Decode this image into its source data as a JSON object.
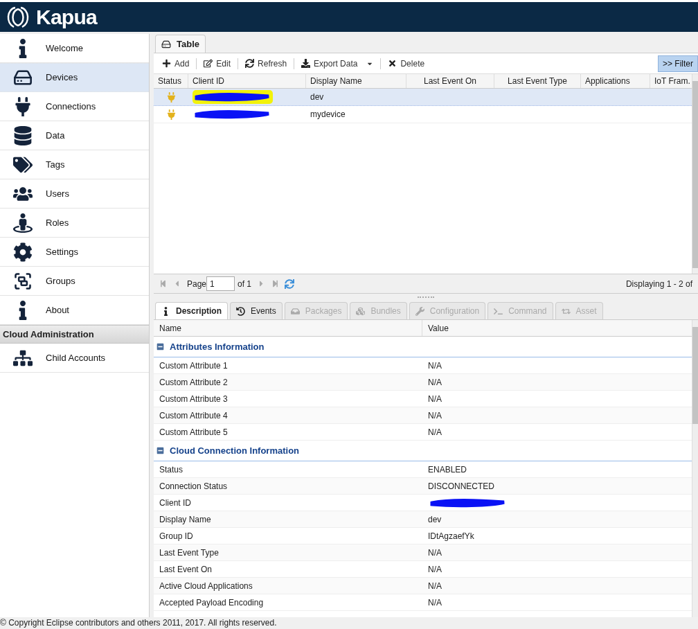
{
  "header": {
    "title": "Kapua"
  },
  "sidebar": {
    "items": [
      {
        "label": "Welcome",
        "selected": false
      },
      {
        "label": "Devices",
        "selected": true
      },
      {
        "label": "Connections",
        "selected": false
      },
      {
        "label": "Data",
        "selected": false
      },
      {
        "label": "Tags",
        "selected": false
      },
      {
        "label": "Users",
        "selected": false
      },
      {
        "label": "Roles",
        "selected": false
      },
      {
        "label": "Settings",
        "selected": false
      },
      {
        "label": "Groups",
        "selected": false
      },
      {
        "label": "About",
        "selected": false
      }
    ],
    "section": {
      "title": "Cloud Administration",
      "items": [
        {
          "label": "Child Accounts",
          "selected": false
        }
      ]
    }
  },
  "main_tab": {
    "label": "Table",
    "selected": true
  },
  "toolbar": {
    "buttons": [
      "Add",
      "Edit",
      "Refresh",
      "Export Data",
      "Delete"
    ],
    "filter_button": ">> Filter"
  },
  "table": {
    "columns": [
      "Status",
      "Client ID",
      "Display Name",
      "Last Event On",
      "Last Event Type",
      "Applications",
      "IoT Fram."
    ],
    "rows": [
      {
        "selected": true,
        "display_name": "dev"
      },
      {
        "selected": false,
        "display_name": "mydevice"
      }
    ]
  },
  "pager": {
    "page_label": "Page",
    "page": "1",
    "of": "of 1",
    "summary": "Displaying 1 - 2 of"
  },
  "detail_tabs": [
    {
      "label": "Description",
      "selected": true,
      "disabled": false
    },
    {
      "label": "Events",
      "selected": false,
      "disabled": false
    },
    {
      "label": "Packages",
      "selected": false,
      "disabled": true
    },
    {
      "label": "Bundles",
      "selected": false,
      "disabled": true
    },
    {
      "label": "Configuration",
      "selected": false,
      "disabled": true
    },
    {
      "label": "Command",
      "selected": false,
      "disabled": true
    },
    {
      "label": "Asset",
      "selected": false,
      "disabled": true
    }
  ],
  "details": {
    "columns": [
      "Name",
      "Value"
    ],
    "groups": [
      {
        "title": "Attributes Information",
        "expanded": true,
        "rows": [
          {
            "kind": "text",
            "name": "Custom Attribute 1",
            "value": "N/A"
          },
          {
            "kind": "text",
            "name": "Custom Attribute 2",
            "value": "N/A"
          },
          {
            "kind": "text",
            "name": "Custom Attribute 3",
            "value": "N/A"
          },
          {
            "kind": "text",
            "name": "Custom Attribute 4",
            "value": "N/A"
          },
          {
            "kind": "text",
            "name": "Custom Attribute 5",
            "value": "N/A"
          }
        ]
      },
      {
        "title": "Cloud Connection Information",
        "expanded": true,
        "rows": [
          {
            "kind": "text",
            "name": "Status",
            "value": "ENABLED"
          },
          {
            "kind": "text",
            "name": "Connection Status",
            "value": "DISCONNECTED"
          },
          {
            "kind": "redacted",
            "name": "Client ID"
          },
          {
            "kind": "text",
            "name": "Display Name",
            "value": "dev"
          },
          {
            "kind": "text",
            "name": "Group ID",
            "value": "IDtAgzaefYk"
          },
          {
            "kind": "text",
            "name": "Last Event Type",
            "value": "N/A"
          },
          {
            "kind": "text",
            "name": "Last Event On",
            "value": "N/A"
          },
          {
            "kind": "text",
            "name": "Active Cloud Applications",
            "value": "N/A"
          },
          {
            "kind": "text",
            "name": "Accepted Payload Encoding",
            "value": "N/A"
          }
        ]
      }
    ]
  },
  "footer": "© Copyright Eclipse contributors and others 2011, 2017. All rights reserved."
}
